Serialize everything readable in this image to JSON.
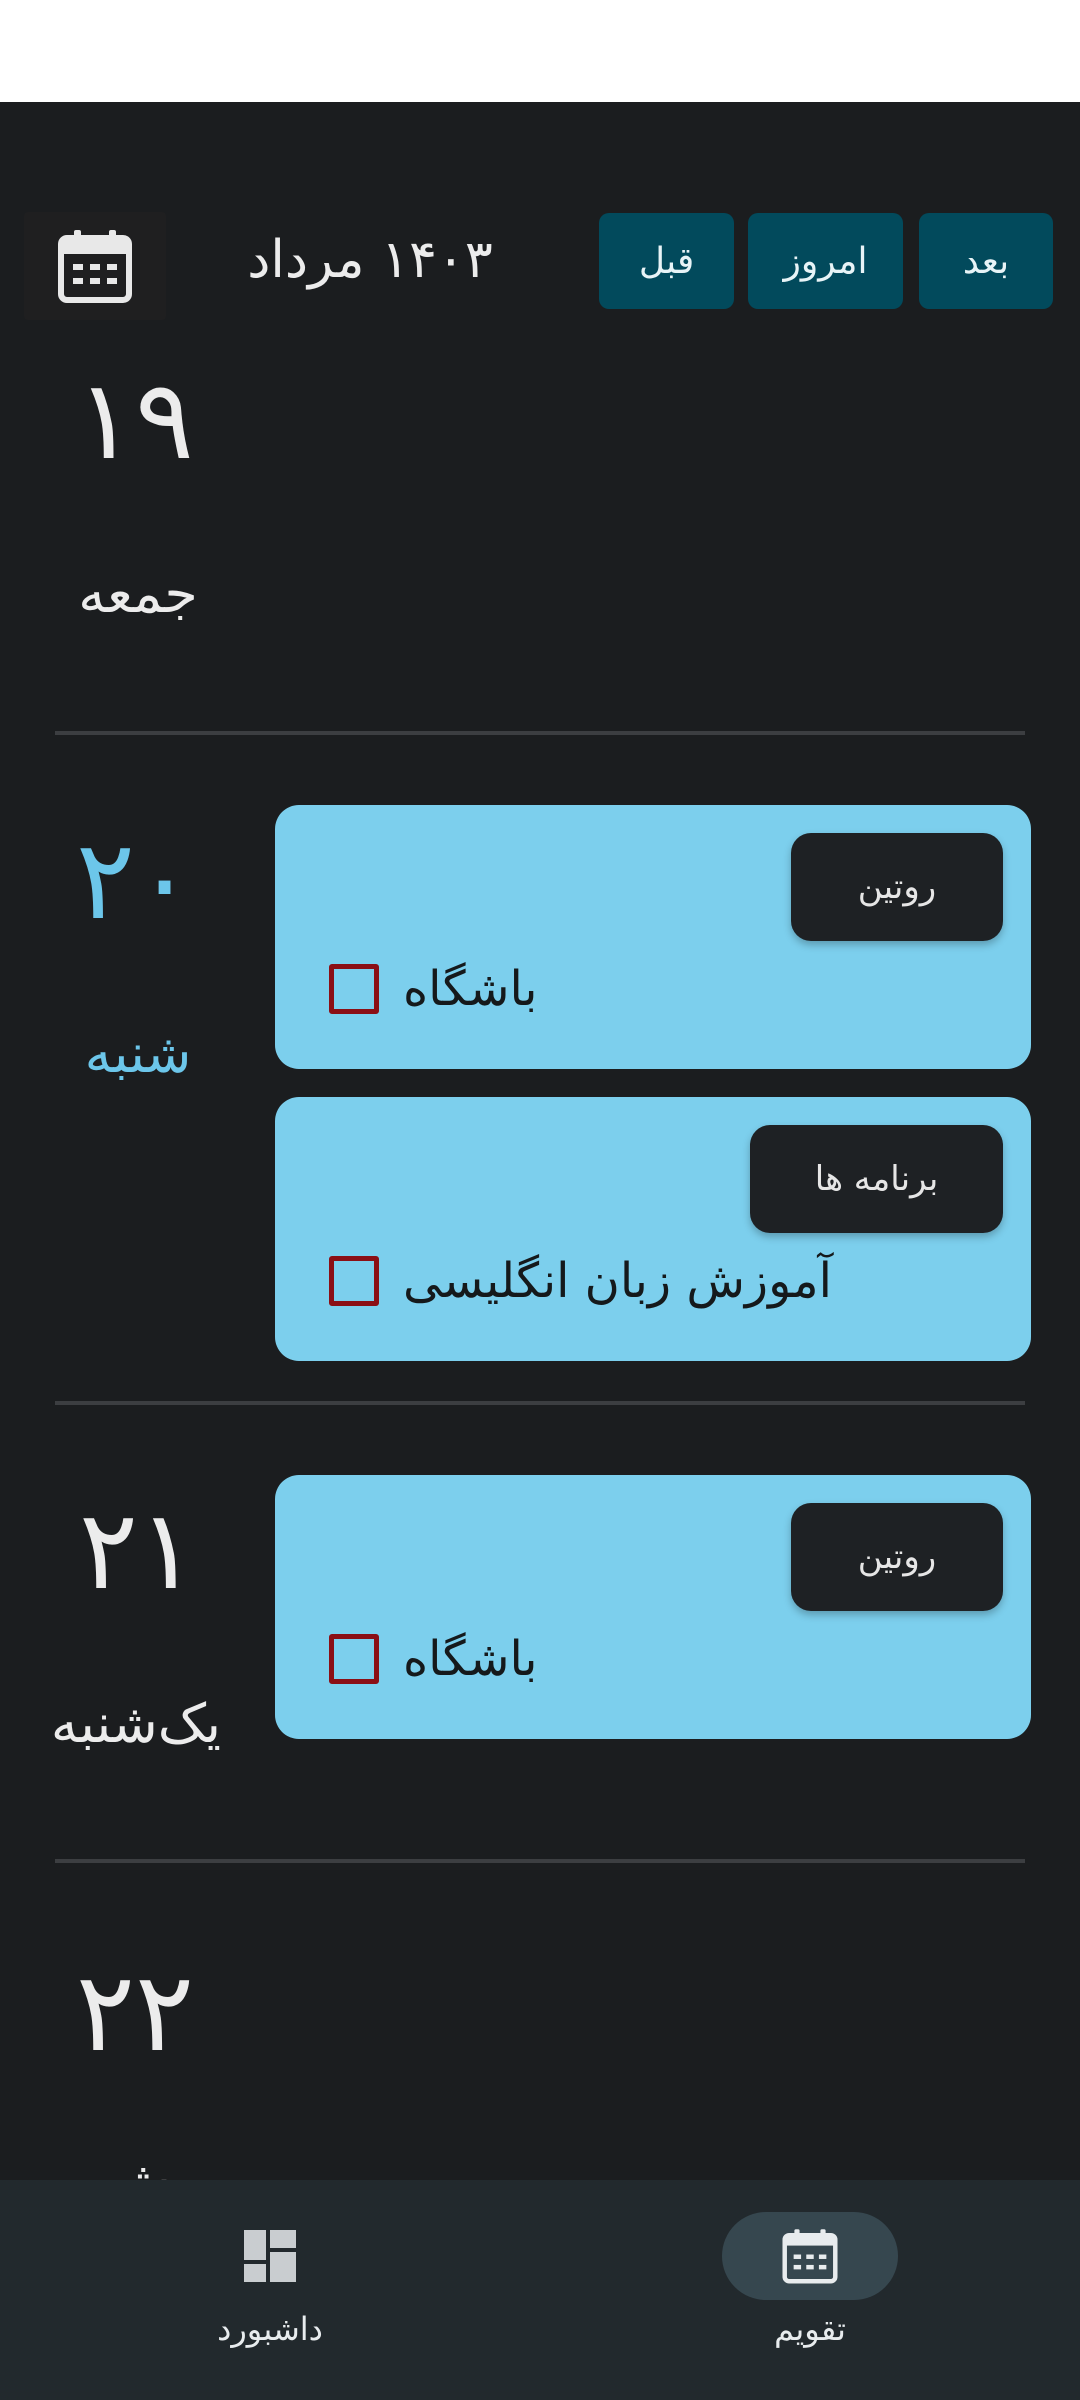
{
  "header": {
    "next_label": "بعد",
    "today_label": "امروز",
    "prev_label": "قبل",
    "month_title": "۱۴۰۳ مرداد",
    "calendar_picker_icon": "calendar-icon"
  },
  "days": [
    {
      "number": "۱۹",
      "name": "جمعه"
    },
    {
      "number": "۲۰",
      "name": "شنبه"
    },
    {
      "number": "۲۱",
      "name": "یک‌شنبه"
    },
    {
      "number": "۲۲",
      "name": "ش"
    }
  ],
  "events": [
    {
      "tag": "روتین",
      "title": "باشگاه",
      "checked": false
    },
    {
      "tag": "برنامه ها",
      "title": "آموزش زبان انگلیسی",
      "checked": false
    },
    {
      "tag": "روتین",
      "title": "باشگاه",
      "checked": false
    }
  ],
  "bottom_nav": {
    "calendar_label": "تقویم",
    "dashboard_label": "داشبورد",
    "active": "calendar"
  },
  "colors": {
    "background": "#1b1d1f",
    "nav_button": "#024a5c",
    "event_card": "#7ccfed",
    "accent_day": "#6cc6ea",
    "checkbox_border": "#8b0f15",
    "tag_bg": "#1e2124"
  }
}
